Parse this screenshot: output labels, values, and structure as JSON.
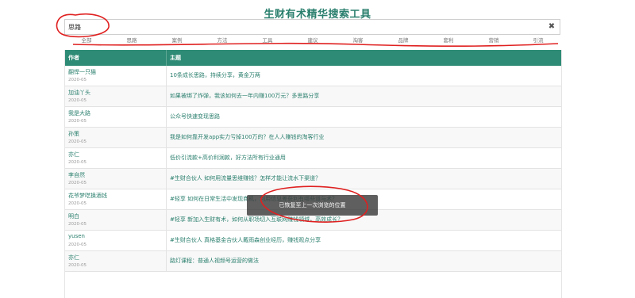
{
  "header": {
    "title": "生财有术精华搜索工具"
  },
  "search": {
    "value": "思路",
    "clear_icon": "close-icon"
  },
  "tabs": [
    "全部",
    "思路",
    "案例",
    "方法",
    "工具",
    "建议",
    "淘客",
    "品牌",
    "套利",
    "营销",
    "引流"
  ],
  "table": {
    "columns": [
      "作者",
      "主题"
    ],
    "rows": [
      {
        "author": "翻悍一只猫",
        "date": "2020-05",
        "topic": "10条成长思路，持续分享，黄金万两"
      },
      {
        "author": "加油丫头",
        "date": "2020-05",
        "topic": "如果被绑了炸弹，我该如何去一年内赚100万元？多思路分享"
      },
      {
        "author": "我是大路",
        "date": "2020-05",
        "topic": "公众号快速变现思路"
      },
      {
        "author": "孙策",
        "date": "2020-05",
        "topic": "我是如何靠开发app实力亏掉100万的？在人人赚钱的淘客行业"
      },
      {
        "author": "亦仁",
        "date": "2020-05",
        "topic": "低价引流款+高价利润款，好方法所有行业通用"
      },
      {
        "author": "李自然",
        "date": "2020-05",
        "topic": "#生财合伙人 如何用流量思维赚钱？怎样才能让流水下渠道？"
      },
      {
        "author": "花爷梦呓换酒钱",
        "date": "2020-05",
        "topic": "#轻享 如何在日常生活中发现商机，利用信息差获利有哪些道与术？"
      },
      {
        "author": "明白",
        "date": "2020-05",
        "topic": "#轻享 新加入生财有术，如何从职场切入互联网赚钱领域，高效成长？"
      },
      {
        "author": "yusen",
        "date": "2020-05",
        "topic": "#生财合伙人 真格基金合伙人戴雨森创业经历，赚钱观点分享"
      },
      {
        "author": "亦仁",
        "date": "2020-05",
        "topic": "路灯课程：普通人视频号运营的做法"
      }
    ]
  },
  "toast": {
    "message": "已恢复至上一次浏览的位置"
  },
  "colors": {
    "accent": "#2e8b75",
    "annotation": "#e02020"
  }
}
